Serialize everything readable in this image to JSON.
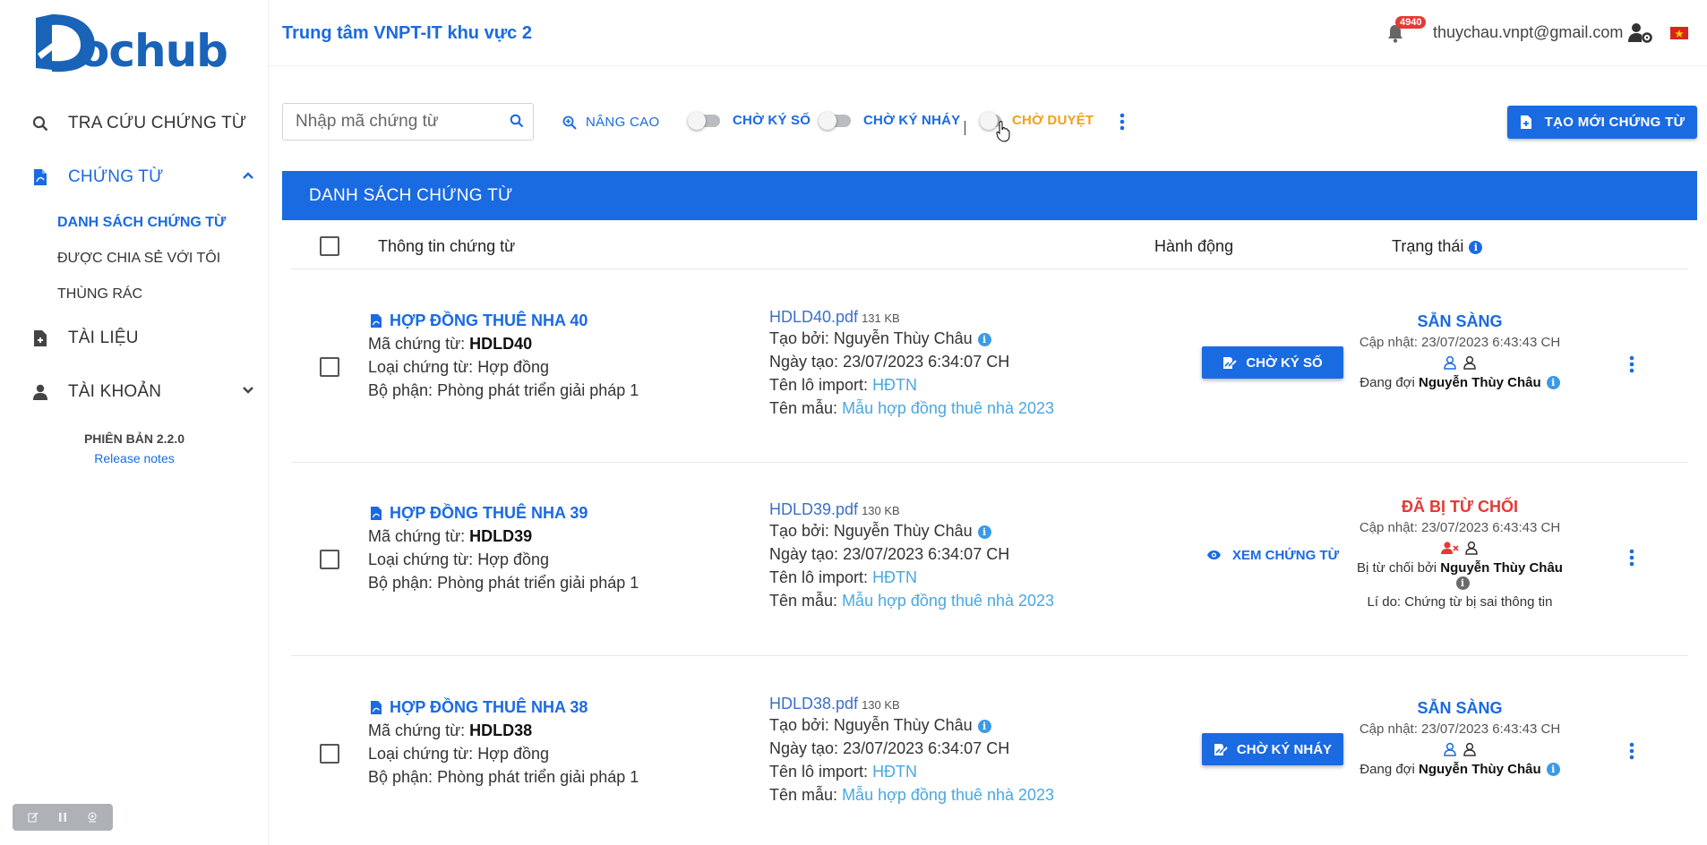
{
  "sidebar": {
    "logo_text": "ochub",
    "nav": {
      "search": "TRA CỨU CHỨNG TỪ",
      "documents": "CHỨNG TỪ",
      "sub_list": "DANH SÁCH CHỨNG TỪ",
      "sub_shared": "ĐƯỢC CHIA SẺ VỚI TÔI",
      "sub_trash": "THÙNG RÁC",
      "files": "TÀI LIỆU",
      "account": "TÀI KHOẢN"
    },
    "version": "PHIÊN BẢN 2.2.0",
    "release_notes": "Release notes"
  },
  "header": {
    "org_title": "Trung tâm VNPT-IT khu vực 2",
    "notification_count": "4940",
    "email": "thuychau.vnpt@gmail.com"
  },
  "toolbar": {
    "search_placeholder": "Nhập mã chứng từ",
    "advanced": "NÂNG CAO",
    "toggle_wait_digital": "CHỜ KÝ SỐ",
    "toggle_wait_initial": "CHỜ KÝ NHÁY",
    "toggle_wait_approve": "CHỜ DUYỆT",
    "create_button": "TẠO MỚI CHỨNG TỪ"
  },
  "list": {
    "title": "DANH SÁCH CHỨNG TỪ",
    "columns": {
      "info": "Thông tin chứng từ",
      "action": "Hành động",
      "status": "Trạng thái"
    },
    "labels": {
      "code": "Mã chứng từ:",
      "type": "Loại chứng từ:",
      "department": "Bộ phận:",
      "created_by": "Tạo bởi:",
      "created_at": "Ngày tạo:",
      "batch": "Tên lô import:",
      "template": "Tên mẫu:",
      "updated": "Cập nhật:",
      "waiting": "Đang đợi",
      "rejected_by": "Bị từ chối bởi",
      "reason": "Lí do:"
    },
    "rows": [
      {
        "title": "HỢP ĐỒNG THUÊ NHA 40",
        "code": "HDLD40",
        "type": "Hợp đồng",
        "department": "Phòng phát triển giải pháp 1",
        "file": "HDLD40.pdf",
        "size": "131 KB",
        "creator": "Nguyễn Thùy Châu",
        "created": "23/07/2023 6:34:07 CH",
        "batch": "HĐTN",
        "template": "Mẫu hợp đồng thuê nhà 2023",
        "action": "CHỜ KÝ SỐ",
        "status": "SẴN SÀNG",
        "updated": "23/07/2023 6:43:43 CH",
        "who": "Nguyễn Thùy Châu"
      },
      {
        "title": "HỢP ĐỒNG THUÊ NHA 39",
        "code": "HDLD39",
        "type": "Hợp đồng",
        "department": "Phòng phát triển giải pháp 1",
        "file": "HDLD39.pdf",
        "size": "130 KB",
        "creator": "Nguyễn Thùy Châu",
        "created": "23/07/2023 6:34:07 CH",
        "batch": "HĐTN",
        "template": "Mẫu hợp đồng thuê nhà 2023",
        "action": "XEM CHỨNG TỪ",
        "status": "ĐÃ BỊ TỪ CHỐI",
        "updated": "23/07/2023 6:43:43 CH",
        "who": "Nguyễn Thùy Châu",
        "reason": "Chứng từ bị sai thông tin"
      },
      {
        "title": "HỢP ĐỒNG THUÊ NHA 38",
        "code": "HDLD38",
        "type": "Hợp đồng",
        "department": "Phòng phát triển giải pháp 1",
        "file": "HDLD38.pdf",
        "size": "130 KB",
        "creator": "Nguyễn Thùy Châu",
        "created": "23/07/2023 6:34:07 CH",
        "batch": "HĐTN",
        "template": "Mẫu hợp đồng thuê nhà 2023",
        "action": "CHỜ KÝ NHÁY",
        "status": "SẴN SÀNG",
        "updated": "23/07/2023 6:43:43 CH",
        "who": "Nguyễn Thùy Châu"
      }
    ]
  },
  "colors": {
    "primary": "#1a6ae2",
    "danger": "#e53935",
    "warning": "#f0a11a",
    "link_light": "#4aa7e0"
  },
  "icons": [
    "search-icon",
    "file-pdf-icon",
    "chevron-up-icon",
    "chevron-down-icon",
    "file-plus-icon",
    "user-icon",
    "bell-icon",
    "user-gear-icon",
    "flag-icon",
    "zoom-in-icon",
    "more-vertical-icon",
    "info-icon",
    "signature-icon",
    "eye-icon",
    "user-x-icon"
  ]
}
